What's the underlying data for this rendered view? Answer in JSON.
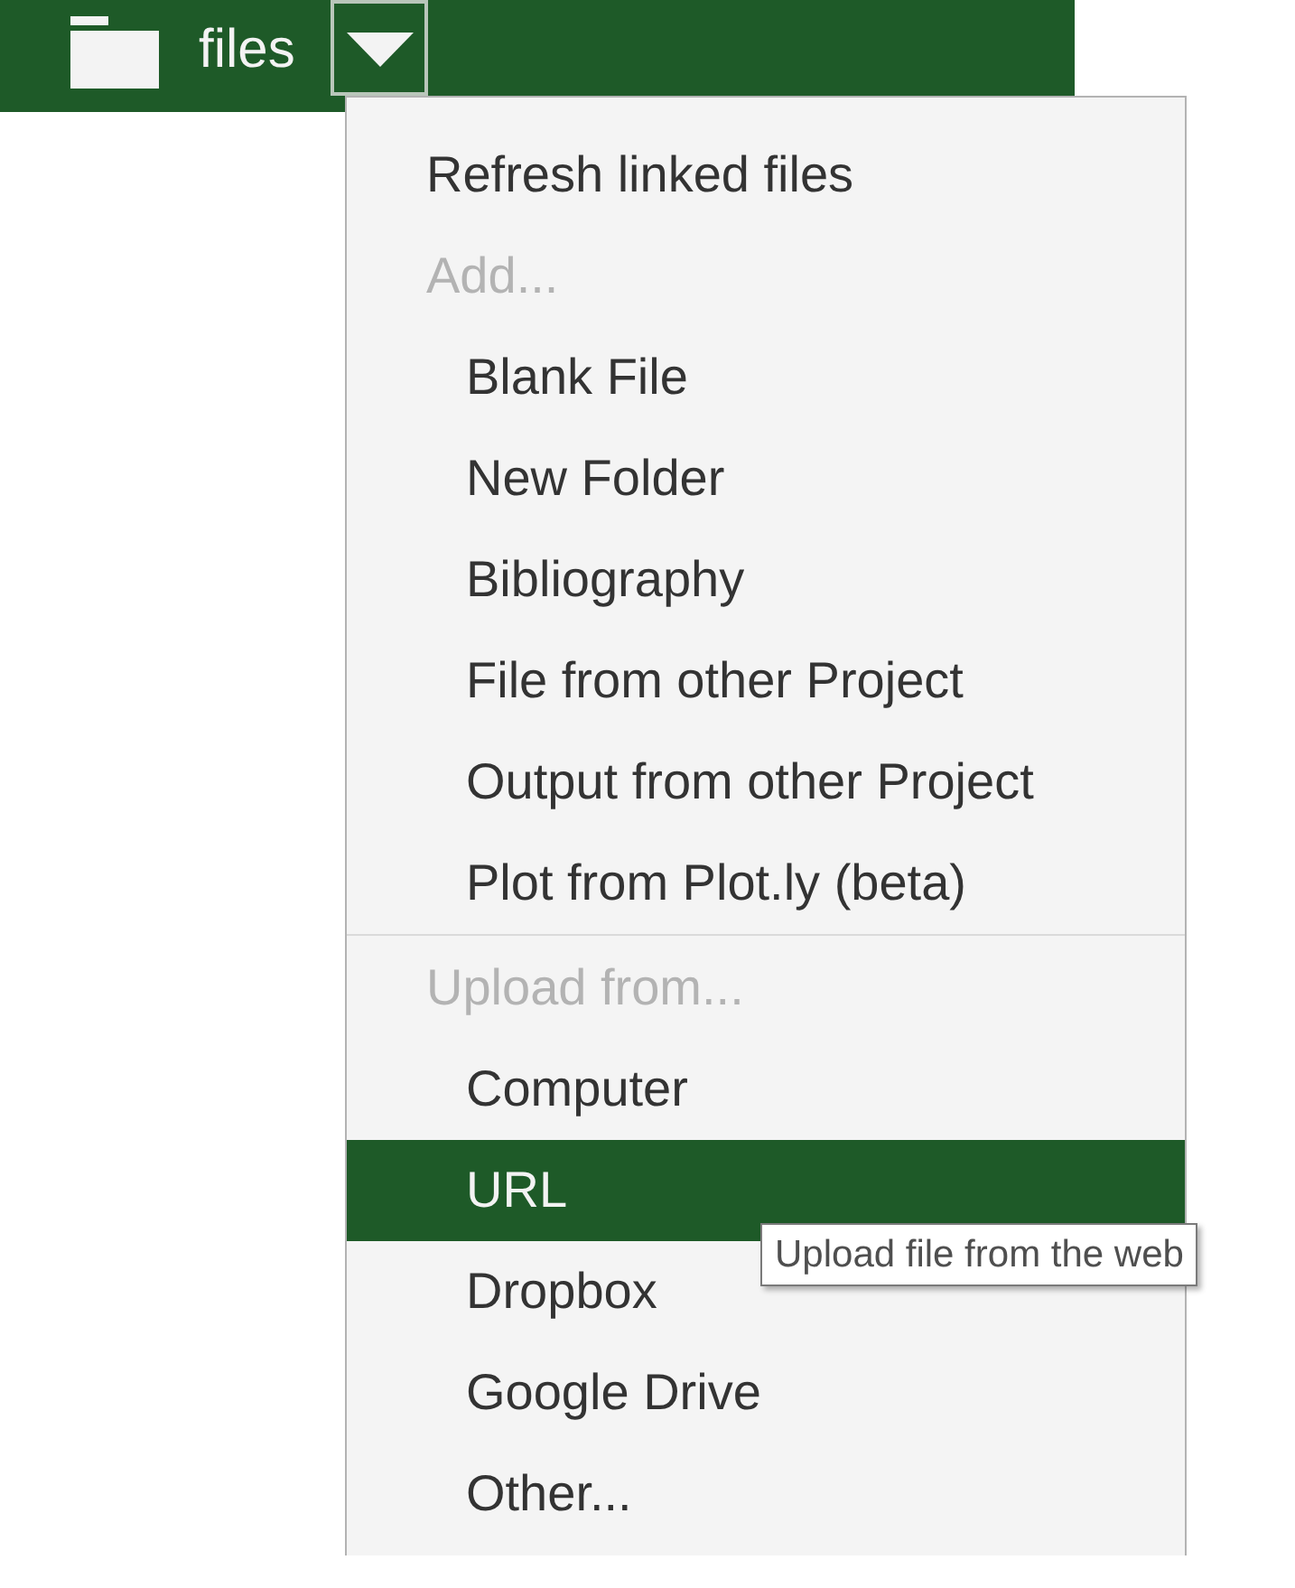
{
  "topbar": {
    "title": "files"
  },
  "menu": {
    "items": [
      {
        "kind": "action",
        "label": "Refresh linked files",
        "selected": false
      },
      {
        "kind": "heading",
        "label": "Add..."
      },
      {
        "kind": "option",
        "label": "Blank File",
        "selected": false
      },
      {
        "kind": "option",
        "label": "New Folder",
        "selected": false
      },
      {
        "kind": "option",
        "label": "Bibliography",
        "selected": false
      },
      {
        "kind": "option",
        "label": "File from other Project",
        "selected": false
      },
      {
        "kind": "option",
        "label": "Output from other Project",
        "selected": false
      },
      {
        "kind": "option",
        "label": "Plot from Plot.ly (beta)",
        "selected": false
      },
      {
        "kind": "separator"
      },
      {
        "kind": "heading",
        "label": "Upload from..."
      },
      {
        "kind": "option",
        "label": "Computer",
        "selected": false
      },
      {
        "kind": "option",
        "label": "URL",
        "selected": true
      },
      {
        "kind": "option",
        "label": "Dropbox",
        "selected": false
      },
      {
        "kind": "option",
        "label": "Google Drive",
        "selected": false
      },
      {
        "kind": "option",
        "label": "Other...",
        "selected": false
      }
    ]
  },
  "tooltip": {
    "text": "Upload file from the web"
  }
}
